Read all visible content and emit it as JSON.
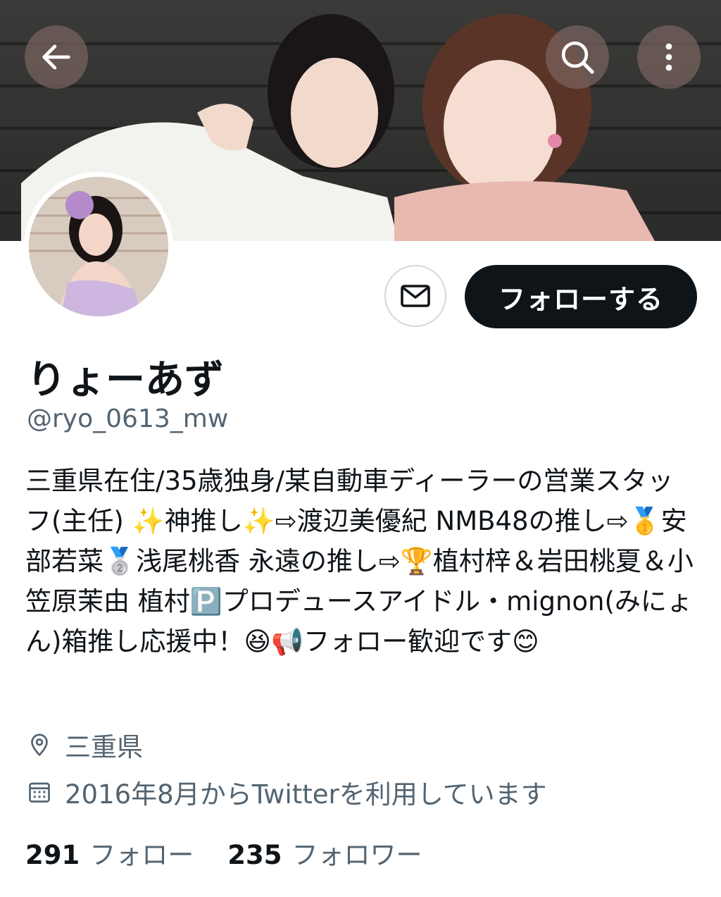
{
  "profile": {
    "display_name": "りょーあず",
    "handle": "@ryo_0613_mw",
    "bio": "三重県在住/35歳独身/某自動車ディーラーの営業スタッフ(主任) ✨神推し✨⇨渡辺美優紀 NMB48の推し⇨🥇安部若菜🥈浅尾桃香 永遠の推し⇨🏆植村梓＆岩田桃夏＆小笠原茉由 植村🅿️プロデュースアイドル・mignon(みにょん)箱推し応援中！😆📢フォロー歓迎です😊",
    "location": "三重県",
    "joined": "2016年8月からTwitterを利用しています"
  },
  "actions": {
    "follow_label": "フォローする"
  },
  "stats": {
    "following_count": "291",
    "following_label": "フォロー",
    "followers_count": "235",
    "followers_label": "フォロワー"
  },
  "icons": {
    "back": "back-arrow-icon",
    "search": "search-icon",
    "more": "more-vertical-icon",
    "message": "mail-icon",
    "location": "location-pin-icon",
    "calendar": "calendar-icon"
  },
  "colors": {
    "follow_button_bg": "#0f1419",
    "secondary_text": "#536471",
    "overlay_button": "#78645f"
  }
}
